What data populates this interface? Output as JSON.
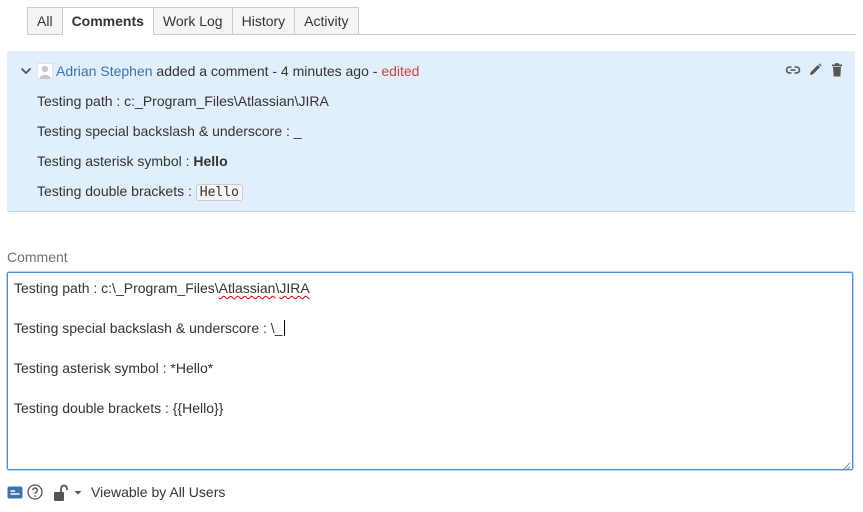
{
  "tabs": [
    {
      "label": "All",
      "active": false
    },
    {
      "label": "Comments",
      "active": true
    },
    {
      "label": "Work Log",
      "active": false
    },
    {
      "label": "History",
      "active": false
    },
    {
      "label": "Activity",
      "active": false
    }
  ],
  "comment": {
    "author": "Adrian Stephen",
    "action": " added a comment - 4 minutes ago - ",
    "edited": "edited",
    "lines": [
      {
        "text": "Testing path : c:_Program_Files\\Atlassian\\JIRA"
      },
      {
        "text": "Testing special backslash & underscore : _"
      },
      {
        "prefix": "Testing asterisk symbol : ",
        "bold": "Hello"
      },
      {
        "prefix": "Testing double brackets : ",
        "code": "Hello"
      }
    ]
  },
  "editor": {
    "label": "Comment",
    "lines": {
      "l1_prefix": "Testing path : c:\\_Program_Files\\",
      "l1_word1": "Atlassian",
      "l1_sep": "\\",
      "l1_word2": "JIRA",
      "l2": "Testing special backslash & underscore : \\_",
      "l3": "Testing asterisk symbol : *Hello*",
      "l4": "Testing double brackets : {{Hello}}"
    }
  },
  "footer": {
    "visibility": "Viewable by All Users"
  },
  "colors": {
    "link": "#3b73af",
    "edited": "#d04437",
    "comment_bg": "#e1eefb",
    "editor_border": "#4a90d9"
  }
}
